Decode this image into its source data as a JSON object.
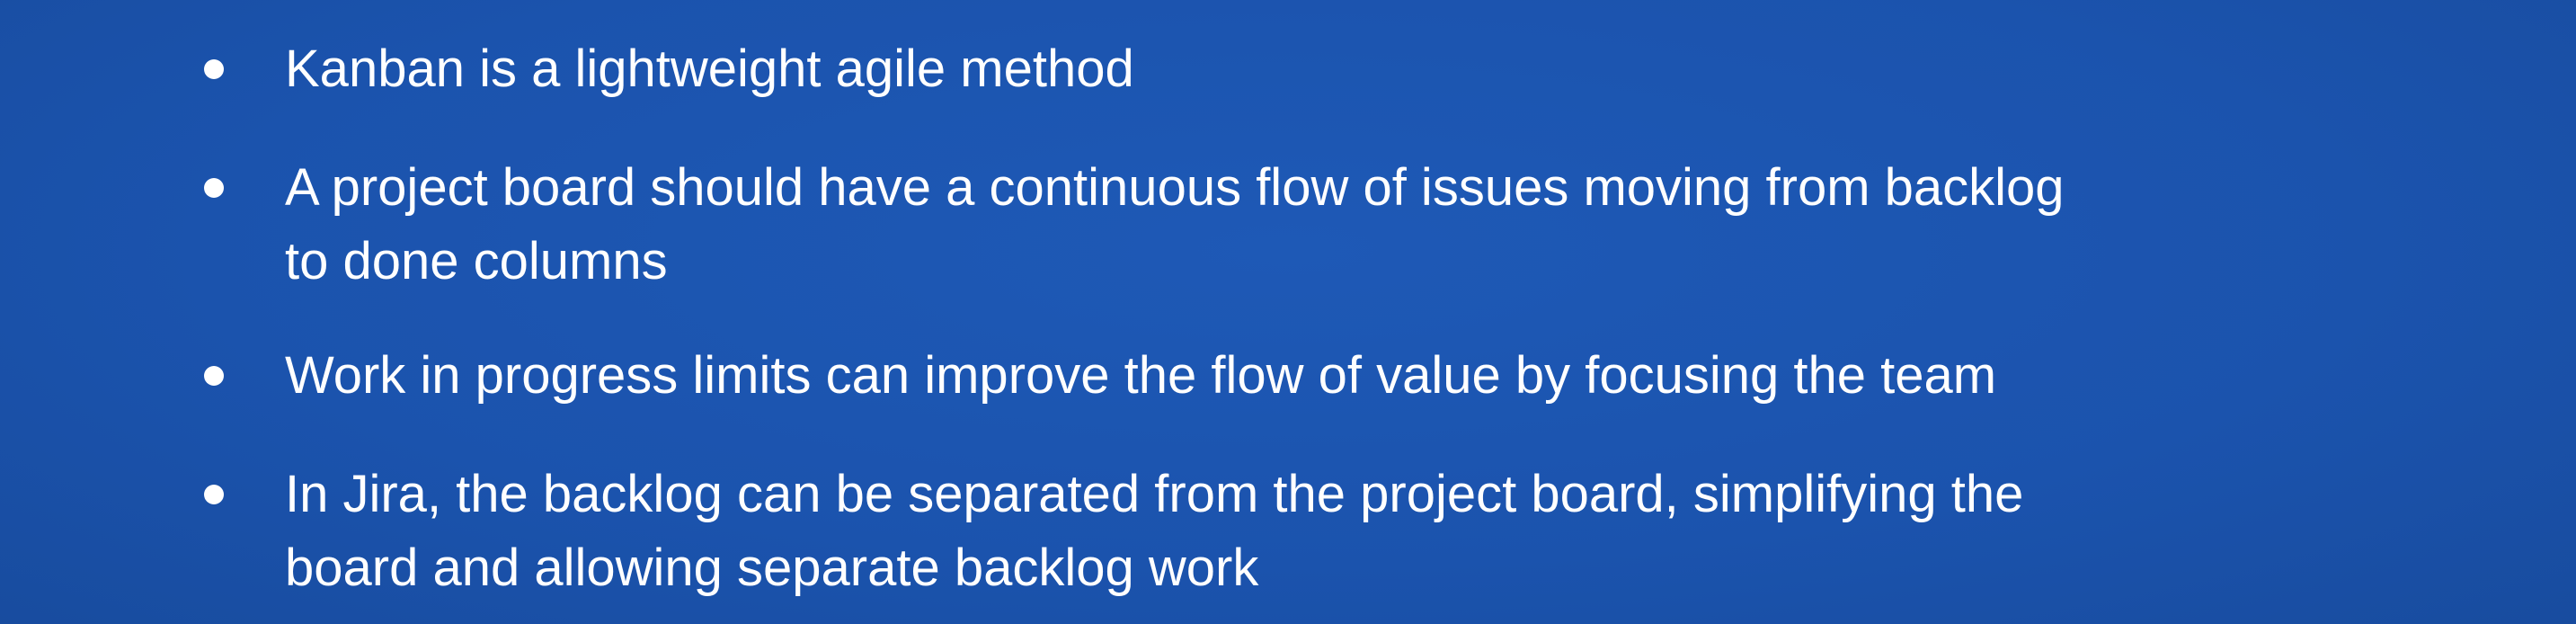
{
  "slide": {
    "background_color": "#1c55b0",
    "text_color": "#ffffff",
    "bullets": [
      {
        "lines": [
          "Kanban is a lightweight agile method"
        ]
      },
      {
        "lines": [
          "A project board should have a continuous flow of issues moving from backlog",
          "to done columns"
        ]
      },
      {
        "lines": [
          "Work in progress limits can improve the flow of value by focusing the team"
        ]
      },
      {
        "lines": [
          "In Jira, the backlog can be separated from the project board, simplifying the",
          "board and allowing separate backlog work"
        ]
      }
    ]
  }
}
